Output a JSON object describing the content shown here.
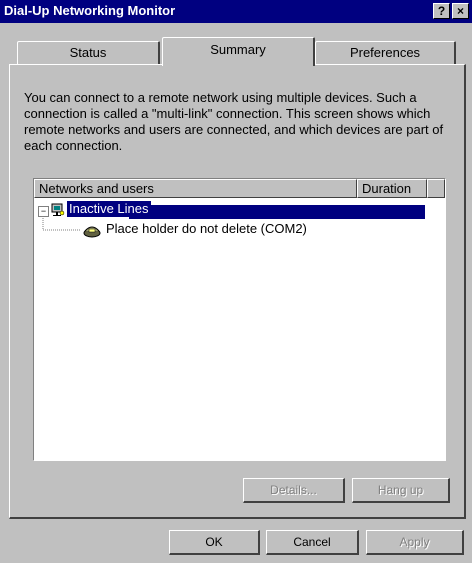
{
  "window": {
    "title": "Dial-Up Networking Monitor",
    "help_button": "?",
    "close_button": "×"
  },
  "tabs": [
    {
      "label": "Status",
      "active": false
    },
    {
      "label": "Summary",
      "active": true
    },
    {
      "label": "Preferences",
      "active": false
    }
  ],
  "summary": {
    "description": "You can connect to a remote network using multiple devices. Such a connection is called a \"multi-link\" connection. This screen shows which remote networks and users are connected, and which devices are part of each connection.",
    "columns": {
      "networks": "Networks and users",
      "duration": "Duration"
    },
    "tree": {
      "root": {
        "label": "Inactive Lines",
        "expanded": true,
        "selected": true,
        "icon": "network-connection-icon"
      },
      "children": [
        {
          "label": "Place holder do not delete (COM2)",
          "icon": "modem-icon"
        }
      ]
    },
    "buttons": {
      "details": "Details...",
      "hang_up": "Hang up"
    }
  },
  "footer": {
    "ok": "OK",
    "cancel": "Cancel",
    "apply": "Apply"
  },
  "colors": {
    "titlebar": "#000080",
    "selection": "#000080",
    "face": "#c0c0c0"
  }
}
